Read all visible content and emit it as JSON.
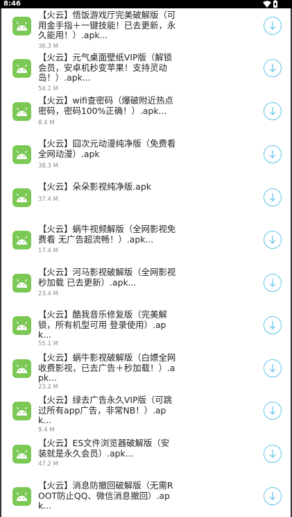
{
  "status_bar": {
    "time": "8:46",
    "icons": [
      "wifi-icon",
      "battery-icon"
    ]
  },
  "colors": {
    "app_icon_bg": "#7cc855",
    "download_accent": "#5ec3e6",
    "title_text": "#222222",
    "size_text": "#888888"
  },
  "apps": [
    {
      "title": "【火云】悟饭游戏厅完美破解版（可用金手指＋一键技能！已去更新，永久能用！）.apk...",
      "size": "36.3 M"
    },
    {
      "title": "【火云】元气桌面壁纸VIP版（解锁会员，安卓机秒变苹果！支持灵动岛！）.apk...",
      "size": "54.1 M"
    },
    {
      "title": "【火云】wifi查密码（爆破附近热点密码，密码100%正确！）.apk...",
      "size": "8.4 M"
    },
    {
      "title": "【火云】囧次元动漫纯净版（免费看全网动漫）.apk",
      "size": "38.3 M"
    },
    {
      "title": "【火云】朵朵影视纯净版.apk",
      "size": "37.4 M"
    },
    {
      "title": "【火云】蜗牛视频解版（全网影视免费看 无广告超流畅！）.apk...",
      "size": "17.4 M"
    },
    {
      "title": "【火云】河马影视破解版（全网影视秒加载 已去更新）.apk...",
      "size": "23.4 M"
    },
    {
      "title": "【火云】酷我音乐修复版（完美解锁，所有机型可用 登录使用）.apk...",
      "size": "55.1 M"
    },
    {
      "title": "【火云】蜗牛影视破解版（白嫖全网收费影视，已去广告＋秒加载！）.apk...",
      "size": "23.2 M"
    },
    {
      "title": "【火云】绿去广告永久VIP版（可跳过所有app广告，非常NB！）.apk...",
      "size": "9.4 M"
    },
    {
      "title": "【火云】ES文件浏览器破解版（安装就是永久会员）.apk...",
      "size": "47.2 M"
    },
    {
      "title": "【火云】消息防撤回破解版（无需ROOT防止QQ、微信消息撤回）.apk...",
      "size": ""
    }
  ]
}
